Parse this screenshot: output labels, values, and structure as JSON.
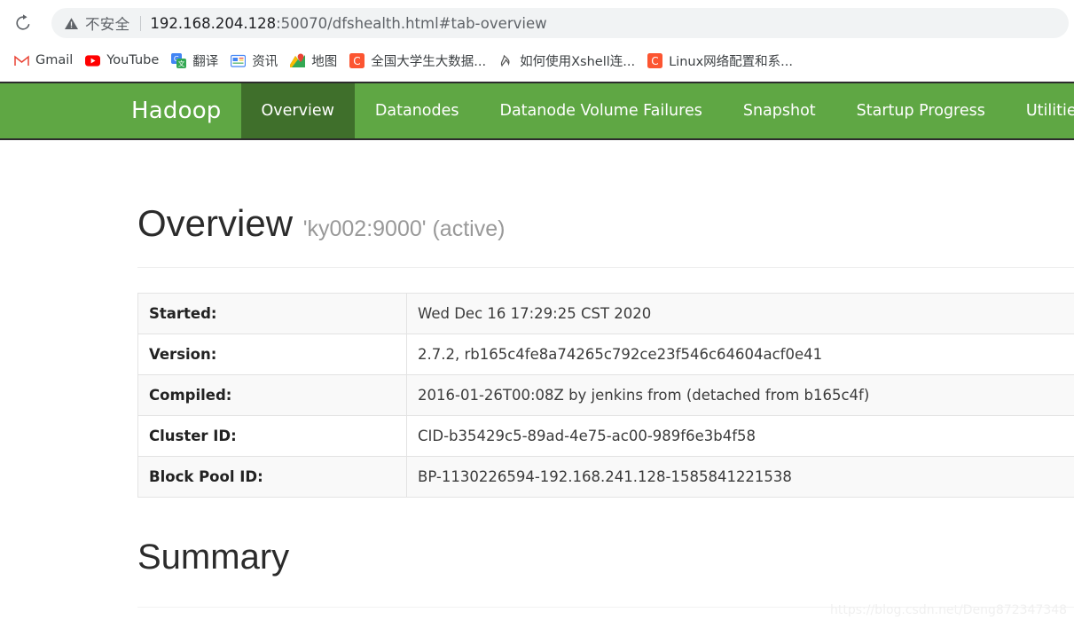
{
  "browser": {
    "reload_icon": "reload-icon",
    "security": {
      "warning_icon": "warning-triangle-icon",
      "label": "不安全"
    },
    "url": {
      "host": "192.168.204.128",
      "rest": ":50070/dfshealth.html#tab-overview",
      "full": "192.168.204.128:50070/dfshealth.html#tab-overview"
    },
    "bookmarks": [
      {
        "label": "Gmail",
        "icon": "gmail-icon",
        "glyph": "M",
        "color": "#ea4335"
      },
      {
        "label": "YouTube",
        "icon": "youtube-icon",
        "glyph": "▶",
        "color": "#ffffff"
      },
      {
        "label": "翻译",
        "icon": "google-translate-icon",
        "glyph": "文",
        "color": "#ffffff"
      },
      {
        "label": "资讯",
        "icon": "google-news-icon",
        "glyph": "news",
        "color": "#1a73e8"
      },
      {
        "label": "地图",
        "icon": "google-maps-icon",
        "glyph": "◈",
        "color": "#34a853"
      },
      {
        "label": "全国大学生大数据...",
        "icon": "csdn-icon",
        "glyph": "C",
        "color": "#ffffff"
      },
      {
        "label": "如何使用Xshell连...",
        "icon": "xshell-icon",
        "glyph": "火",
        "color": "#555555"
      },
      {
        "label": "Linux网络配置和系...",
        "icon": "csdn-icon",
        "glyph": "C",
        "color": "#ffffff"
      }
    ]
  },
  "navbar": {
    "brand": "Hadoop",
    "items": [
      {
        "label": "Overview",
        "active": true
      },
      {
        "label": "Datanodes",
        "active": false
      },
      {
        "label": "Datanode Volume Failures",
        "active": false
      },
      {
        "label": "Snapshot",
        "active": false
      },
      {
        "label": "Startup Progress",
        "active": false
      },
      {
        "label": "Utilities",
        "active": false,
        "dropdown": true
      }
    ],
    "bg_color": "#5fa744",
    "active_bg_color": "#3f6f2b"
  },
  "overview": {
    "heading": "Overview",
    "subtitle": "'ky002:9000' (active)",
    "rows": [
      {
        "label": "Started:",
        "value": "Wed Dec 16 17:29:25 CST 2020"
      },
      {
        "label": "Version:",
        "value": "2.7.2, rb165c4fe8a74265c792ce23f546c64604acf0e41"
      },
      {
        "label": "Compiled:",
        "value": "2016-01-26T00:08Z by jenkins from (detached from b165c4f)"
      },
      {
        "label": "Cluster ID:",
        "value": "CID-b35429c5-89ad-4e75-ac00-989f6e3b4f58"
      },
      {
        "label": "Block Pool ID:",
        "value": "BP-1130226594-192.168.241.128-1585841221538"
      }
    ]
  },
  "summary": {
    "heading": "Summary"
  },
  "watermark": "https://blog.csdn.net/Deng872347348"
}
